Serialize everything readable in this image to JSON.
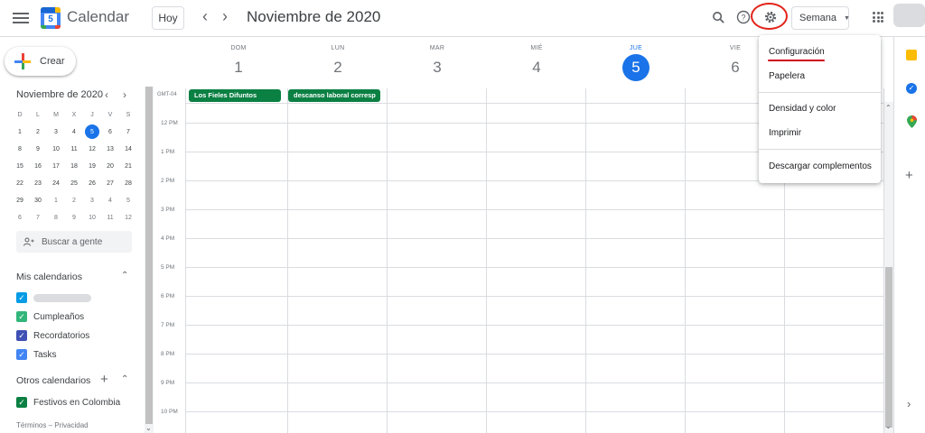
{
  "header": {
    "app_title": "Calendar",
    "logo_day": "5",
    "today_button": "Hoy",
    "range_title": "Noviembre de 2020",
    "view_select": "Semana"
  },
  "sidebar": {
    "create_label": "Crear",
    "mini_month_title": "Noviembre de 2020",
    "mini_dow": [
      "D",
      "L",
      "M",
      "X",
      "J",
      "V",
      "S"
    ],
    "mini_days": [
      "1",
      "2",
      "3",
      "4",
      "5",
      "6",
      "7",
      "8",
      "9",
      "10",
      "11",
      "12",
      "13",
      "14",
      "15",
      "16",
      "17",
      "18",
      "19",
      "20",
      "21",
      "22",
      "23",
      "24",
      "25",
      "26",
      "27",
      "28",
      "29",
      "30",
      "1",
      "2",
      "3",
      "4",
      "5",
      "6",
      "7",
      "8",
      "9",
      "10",
      "11",
      "12"
    ],
    "search_people": "Buscar a gente",
    "my_calendars_title": "Mis calendarios",
    "my_calendars": [
      {
        "label": "",
        "color": "#039be5"
      },
      {
        "label": "Cumpleaños",
        "color": "#33b679"
      },
      {
        "label": "Recordatorios",
        "color": "#3f51b5"
      },
      {
        "label": "Tasks",
        "color": "#4285f4"
      }
    ],
    "other_calendars_title": "Otros calendarios",
    "other_calendars": [
      {
        "label": "Festivos en Colombia",
        "color": "#0b8043"
      }
    ],
    "footer": "Términos – Privacidad"
  },
  "week": {
    "days": [
      {
        "name": "DOM",
        "date": "1"
      },
      {
        "name": "LUN",
        "date": "2"
      },
      {
        "name": "MAR",
        "date": "3"
      },
      {
        "name": "MIÉ",
        "date": "4"
      },
      {
        "name": "JUE",
        "date": "5"
      },
      {
        "name": "VIE",
        "date": "6"
      }
    ],
    "timezone": "GMT-04",
    "all_day_events": [
      {
        "title": "Los Fieles Difuntos",
        "color": "#0b8043"
      },
      {
        "title": "descanso laboral corresp",
        "color": "#0b8043"
      }
    ],
    "hours": [
      "12 PM",
      "1 PM",
      "2 PM",
      "3 PM",
      "4 PM",
      "5 PM",
      "6 PM",
      "7 PM",
      "8 PM",
      "9 PM",
      "10 PM"
    ]
  },
  "settings_menu": {
    "items": [
      "Configuración",
      "Papelera",
      "Densidad y color",
      "Imprimir",
      "Descargar complementos"
    ]
  },
  "colors": {
    "accent": "#1a73e8",
    "highlight": "#e2231a"
  }
}
